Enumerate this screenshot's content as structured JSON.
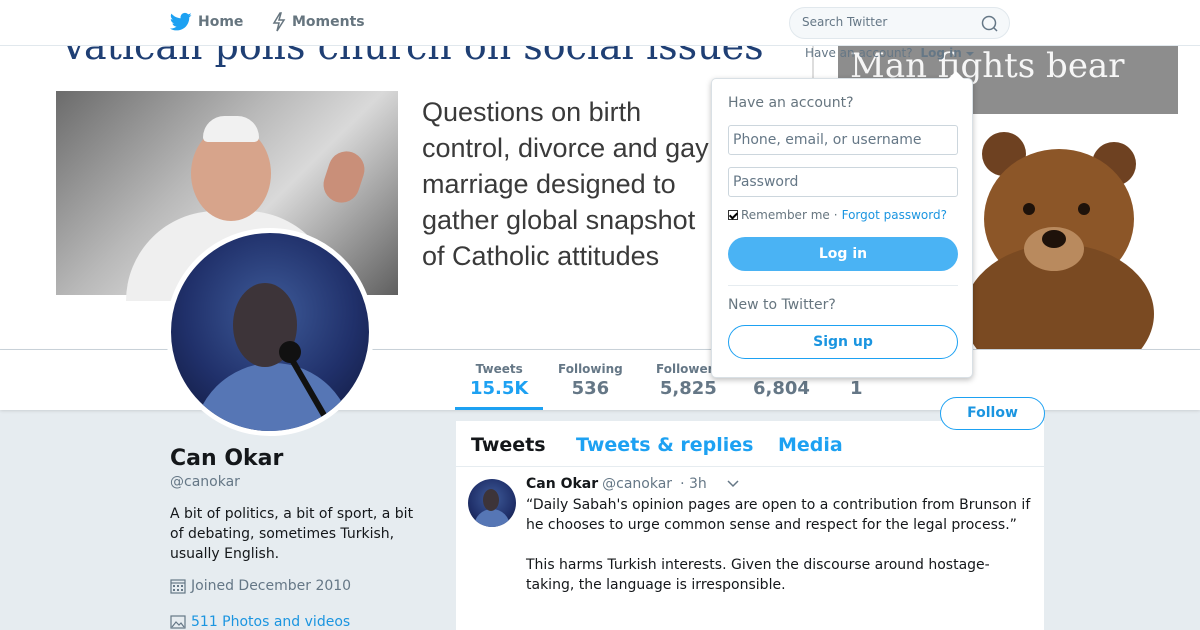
{
  "nav": {
    "home_label": "Home",
    "moments_label": "Moments",
    "search_placeholder": "Search Twitter"
  },
  "login_strip": {
    "have_account": "Have an account?",
    "login_label": "Log in"
  },
  "login_dropdown": {
    "heading": "Have an account?",
    "username_placeholder": "Phone, email, or username",
    "password_placeholder": "Password",
    "remember_label": "Remember me",
    "separator": "·",
    "forgot_label": "Forgot password?",
    "login_button": "Log in",
    "new_to_label": "New to Twitter?",
    "signup_button": "Sign up"
  },
  "banner": {
    "headline": "Vatican polls church on social issues",
    "article_text": "Questions on birth control, divorce and gay marriage designed to gather global snapshot of Catholic attitudes",
    "bear_headline": "Man fights bear"
  },
  "stats": [
    {
      "label": "Tweets",
      "value": "15.5K"
    },
    {
      "label": "Following",
      "value": "536"
    },
    {
      "label": "Followers",
      "value": "5,825"
    },
    {
      "label": "",
      "value": "6,804"
    },
    {
      "label": "",
      "value": "1"
    }
  ],
  "follow_button": "Follow",
  "profile": {
    "name": "Can Okar",
    "handle": "@canokar",
    "bio": "A bit of politics, a bit of sport, a bit of debating, sometimes Turkish, usually English.",
    "joined": "Joined December 2010",
    "photos": "511 Photos and videos"
  },
  "timeline": {
    "tabs": [
      "Tweets",
      "Tweets & replies",
      "Media"
    ],
    "tweet": {
      "name": "Can Okar",
      "handle": "@canokar",
      "time": "· 3h",
      "text1": "“Daily Sabah's opinion pages are open to a contribution from Brunson if he chooses to urge common sense and respect for the legal process.”",
      "text2": "This harms Turkish interests. Given the discourse around hostage-taking, the language is irresponsible."
    }
  },
  "colors": {
    "accent": "#1da1f2",
    "link": "#1b95e0",
    "muted": "#657786",
    "background": "#e6ecf0"
  },
  "icons": {
    "nav_home": "twitter-bird-icon",
    "nav_moments": "lightning-icon",
    "search": "search-icon",
    "caret": "chevron-down-icon",
    "joined": "calendar-icon",
    "photos": "photo-icon"
  }
}
